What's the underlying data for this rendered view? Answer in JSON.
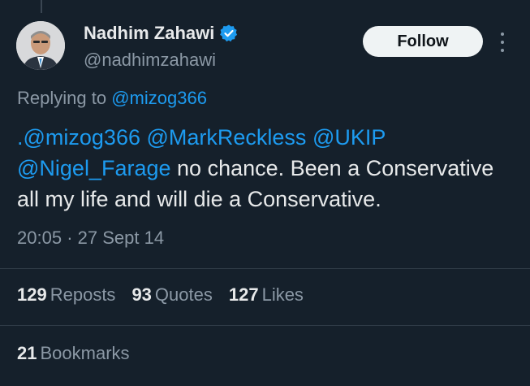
{
  "author": {
    "display_name": "Nadhim Zahawi",
    "handle": "@nadhimzahawi",
    "verified": true
  },
  "follow_label": "Follow",
  "reply_context": {
    "prefix": "Replying to",
    "handle": "@mizog366"
  },
  "tweet": {
    "mention_1": ".@mizog366",
    "mention_2": "@MarkReckless",
    "mention_3": "@UKIP",
    "mention_4": "@Nigel_Farage",
    "body": "no chance. Been a Conservative all my life and will die a Conservative."
  },
  "timestamp": {
    "time": "20:05",
    "separator": "·",
    "date": "27 Sept 14"
  },
  "stats": {
    "reposts_count": "129",
    "reposts_label": "Reposts",
    "quotes_count": "93",
    "quotes_label": "Quotes",
    "likes_count": "127",
    "likes_label": "Likes",
    "bookmarks_count": "21",
    "bookmarks_label": "Bookmarks"
  },
  "colors": {
    "background": "#15202b",
    "link": "#1d9bf0",
    "muted": "#8b98a5",
    "text": "#e7e9ea"
  },
  "icons": {
    "verified": "verified-badge-icon",
    "more": "more-options-icon"
  }
}
